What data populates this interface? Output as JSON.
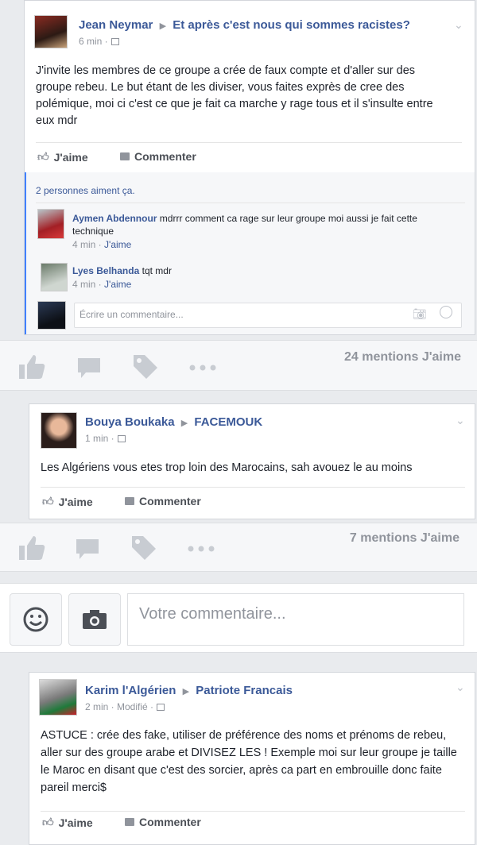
{
  "post1": {
    "author": "Jean Neymar",
    "group": "Et après c'est nous qui sommes racistes?",
    "time": "6 min ·",
    "body": "J'invite les membres de ce groupe a crée de faux compte et d'aller sur des groupe rebeu. Le but étant de les diviser, vous faites exprès de cree des polémique, moi ci c'est ce que je fait ca marche y rage tous et il s'insulte entre eux mdr",
    "like_label": "J'aime",
    "comment_label": "Commenter",
    "likes_summary": "2 personnes aiment ça.",
    "comments": [
      {
        "author": "Aymen Abdennour",
        "text": "mdrrr comment ca rage sur leur groupe moi aussi je fait cette technique",
        "time": "4 min ·",
        "like": "J'aime"
      },
      {
        "author": "Lyes Belhanda",
        "text": "tqt mdr",
        "time": "4 min ·",
        "like": "J'aime"
      }
    ],
    "comment_placeholder": "Écrire un commentaire..."
  },
  "bar1": {
    "mentions": "24 mentions J'aime"
  },
  "post2": {
    "author": "Bouya Boukaka",
    "group": "FACEMOUK",
    "time": "1 min ·",
    "body": "Les Algériens vous etes trop loin des Marocains, sah avouez le au moins",
    "like_label": "J'aime",
    "comment_label": "Commenter"
  },
  "bar2": {
    "mentions": "7 mentions J'aime"
  },
  "composer": {
    "placeholder": "Votre commentaire..."
  },
  "post3": {
    "author": "Karim l'Algérien",
    "group": "Patriote Francais",
    "time": "2 min · Modifié ·",
    "body": "ASTUCE : crée des fake, utiliser de préférence des noms et prénoms de rebeu, aller sur des groupe arabe et DIVISEZ LES ! Exemple moi sur leur groupe je taille le Maroc en disant que c'est des sorcier, après ca part en embrouille donc faite pareil merci$",
    "like_label": "J'aime",
    "comment_label": "Commenter"
  },
  "colors": {
    "link": "#3b5998",
    "meta": "#90949c",
    "bg": "#e9ebee",
    "icon": "#bec2c9"
  }
}
